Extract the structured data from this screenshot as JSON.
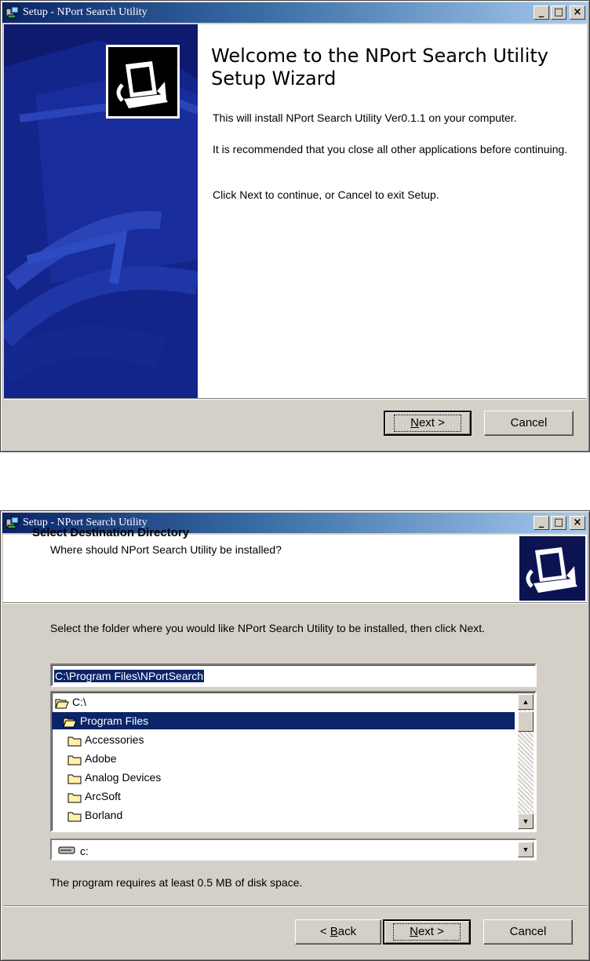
{
  "window1": {
    "title": "Setup - NPort Search Utility",
    "heading": "Welcome to the NPort Search Utility Setup Wizard",
    "paragraphs": [
      "This will install NPort Search Utility Ver0.1.1 on your computer.",
      "It is recommended that you close all other applications before continuing.",
      "Click Next to continue, or Cancel to exit Setup."
    ],
    "next_label_ul": "N",
    "next_label_rest": "ext >",
    "cancel_label": "Cancel"
  },
  "window2": {
    "title": "Setup - NPort Search Utility",
    "header_title": "Select Destination Directory",
    "header_subtitle": "Where should NPort Search Utility be installed?",
    "instruction": "Select the folder where you would like NPort Search Utility to be installed, then click Next.",
    "path_value": "C:\\Program Files\\NPortSearch",
    "folders": [
      {
        "label": "C:\\",
        "open": true,
        "selected": false
      },
      {
        "label": "Program Files",
        "open": true,
        "selected": true
      },
      {
        "label": "Accessories",
        "open": false,
        "selected": false
      },
      {
        "label": "Adobe",
        "open": false,
        "selected": false
      },
      {
        "label": "Analog Devices",
        "open": false,
        "selected": false
      },
      {
        "label": "ArcSoft",
        "open": false,
        "selected": false
      },
      {
        "label": "Borland",
        "open": false,
        "selected": false
      }
    ],
    "drive_label": "c:",
    "disk_space": "The program requires at least 0.5 MB of disk space.",
    "back_prefix": "< ",
    "back_ul": "B",
    "back_rest": "ack",
    "next_label_ul": "N",
    "next_label_rest": "ext >",
    "cancel_label": "Cancel"
  },
  "colors": {
    "title_gradient_start": "#0a246a",
    "title_gradient_end": "#a6caf0",
    "selection": "#0a246a",
    "dialog_face": "#d4d0c8",
    "side_panel": "#0d1a6e"
  }
}
